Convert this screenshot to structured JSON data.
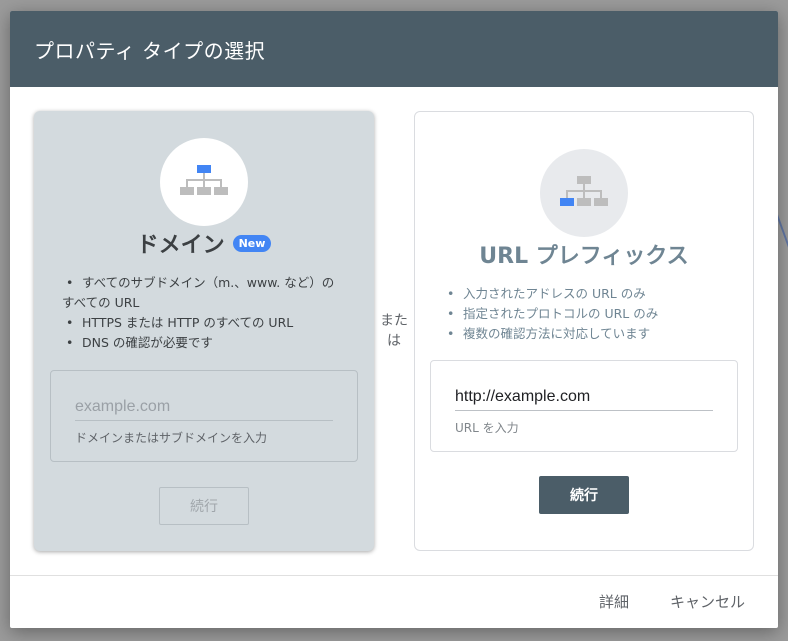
{
  "dialog": {
    "title": "プロパティ タイプの選択"
  },
  "domain_card": {
    "title": "ドメイン",
    "badge": "New",
    "features": [
      "すべてのサブドメイン（m.、www. など）の",
      "すべての URL",
      "HTTPS または HTTP のすべての URL",
      "DNS の確認が必要です"
    ],
    "input_placeholder": "example.com",
    "input_value": "",
    "helper": "ドメインまたはサブドメインを入力",
    "continue_label": "続行",
    "icon": "sitemap-icon"
  },
  "or_label": "また\nは",
  "or_parts": [
    "また",
    "は"
  ],
  "url_card": {
    "title": "URL プレフィックス",
    "features": [
      "入力されたアドレスの URL のみ",
      "指定されたプロトコルの URL のみ",
      "複数の確認方法に対応しています"
    ],
    "input_value": "http://example.com",
    "helper": "URL を入力",
    "continue_label": "続行",
    "icon": "sitemap-icon"
  },
  "footer": {
    "detail_label": "詳細",
    "cancel_label": "キャンセル"
  },
  "colors": {
    "header": "#4b5d68",
    "accent_blue": "#4285f4",
    "domain_card_bg": "#d3dade"
  }
}
